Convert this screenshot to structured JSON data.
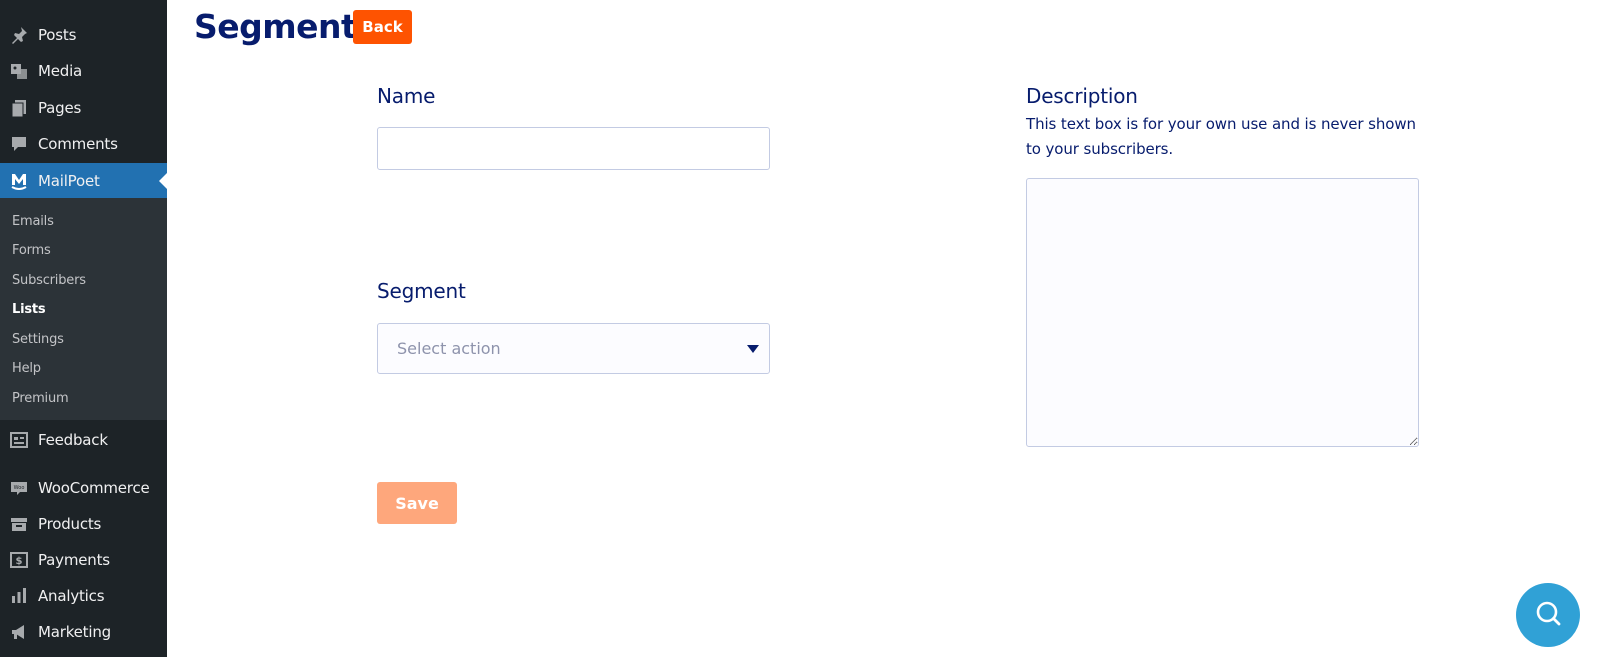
{
  "sidebar": {
    "items_top": [
      {
        "label": "Posts",
        "icon": "pin-icon"
      },
      {
        "label": "Media",
        "icon": "media-icon"
      },
      {
        "label": "Pages",
        "icon": "pages-icon"
      },
      {
        "label": "Comments",
        "icon": "comment-icon"
      }
    ],
    "active": {
      "label": "MailPoet",
      "icon": "mailpoet-icon"
    },
    "submenu": [
      "Emails",
      "Forms",
      "Subscribers",
      "Lists",
      "Settings",
      "Help",
      "Premium"
    ],
    "current_submenu": "Lists",
    "items_bottom": [
      {
        "label": "Feedback",
        "icon": "feedback-icon"
      },
      {
        "label": "WooCommerce",
        "icon": "woocommerce-icon"
      },
      {
        "label": "Products",
        "icon": "products-icon"
      },
      {
        "label": "Payments",
        "icon": "payments-icon"
      },
      {
        "label": "Analytics",
        "icon": "analytics-icon"
      },
      {
        "label": "Marketing",
        "icon": "marketing-icon"
      }
    ]
  },
  "header": {
    "title": "Segment",
    "back_label": "Back"
  },
  "form": {
    "name_label": "Name",
    "name_value": "",
    "segment_label": "Segment",
    "segment_placeholder": "Select action",
    "description_label": "Description",
    "description_help": "This text box is for your own use and is never shown to your subscribers.",
    "description_value": "",
    "save_label": "Save"
  },
  "colors": {
    "sidebar_bg": "#1d2327",
    "active_bg": "#2271b1",
    "title": "#071c6d",
    "back_button": "#fe5301",
    "save_button": "#fea77c",
    "help_fab": "#30a1d6"
  }
}
